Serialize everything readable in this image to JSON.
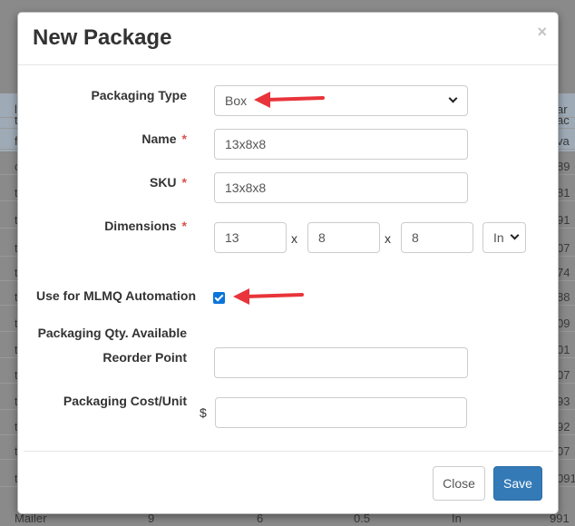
{
  "background": {
    "left_fragments": [
      "l",
      "t",
      "f",
      "c",
      "t",
      "t",
      "t",
      "t",
      "t",
      "t",
      "t",
      "t",
      "t",
      "t",
      "t",
      "t"
    ],
    "right_fragments": [
      "ar",
      "ac",
      "va",
      "89",
      "81",
      "91",
      "07",
      "74",
      "88",
      "09",
      "01",
      "07",
      "93",
      "92",
      "07",
      "091"
    ],
    "bottom_row": [
      "Mailer",
      "9",
      "6",
      "0.5",
      "In",
      "991"
    ]
  },
  "modal": {
    "title": "New Package",
    "close_icon": "×",
    "fields": {
      "packaging_type": {
        "label": "Packaging Type",
        "value": "Box"
      },
      "name": {
        "label": "Name",
        "required_mark": "*",
        "value": "13x8x8"
      },
      "sku": {
        "label": "SKU",
        "required_mark": "*",
        "value": "13x8x8"
      },
      "dimensions": {
        "label": "Dimensions",
        "required_mark": "*",
        "length": "13",
        "width": "8",
        "height": "8",
        "separator": "x",
        "unit": "In"
      },
      "mlmq_automation": {
        "label": "Use for MLMQ Automation",
        "checked": true
      },
      "qty_available": {
        "label": "Packaging Qty. Available"
      },
      "reorder_point": {
        "label": "Reorder Point",
        "value": ""
      },
      "cost_unit": {
        "label": "Packaging Cost/Unit",
        "currency": "$",
        "value": ""
      }
    },
    "footer": {
      "close_label": "Close",
      "save_label": "Save"
    }
  },
  "colors": {
    "primary": "#337ab7",
    "required": "#d9534f",
    "annotation_arrow": "#e8343a",
    "checkbox": "#0a74da"
  },
  "icons": {
    "select_caret": "chevron-down-icon",
    "annotation": "red-arrow-icon"
  }
}
